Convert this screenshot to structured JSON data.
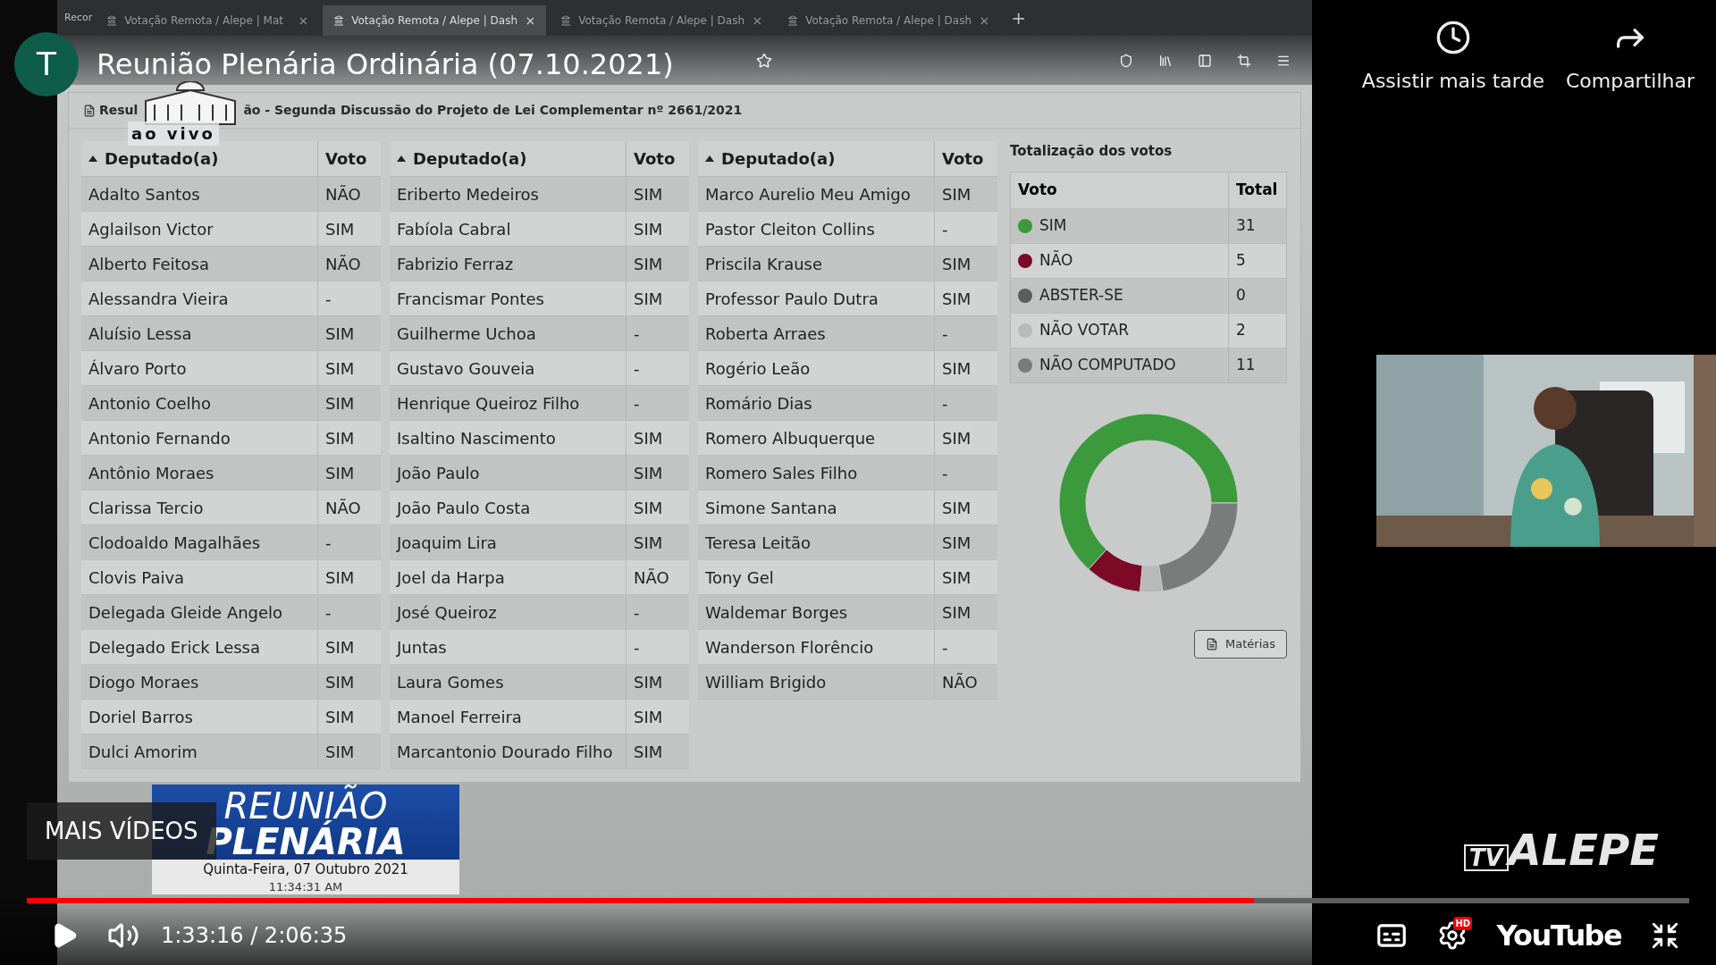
{
  "video": {
    "channel_initial": "T",
    "title": "Reunião Plenária Ordinária (07.10.2021)"
  },
  "browser": {
    "recording_label": "Recor",
    "tabs": [
      {
        "label": "Votação Remota / Alepe | Mat",
        "close": "×",
        "selected": false
      },
      {
        "label": "Votação Remota / Alepe | Dash",
        "close": "×",
        "selected": true
      },
      {
        "label": "Votação Remota / Alepe | Dash",
        "close": "×",
        "selected": false
      },
      {
        "label": "Votação Remota / Alepe | Dash",
        "close": "×",
        "selected": false
      }
    ],
    "new_tab": "+"
  },
  "panel": {
    "title_start": "Resul",
    "title_end": "ão - Segunda Discussão do Projeto de Lei Complementar nº 2661/2021",
    "live_label": "ao vivo"
  },
  "tables": [
    {
      "columns": [
        "Deputado(a)",
        "Voto"
      ],
      "rows": [
        [
          "Adalto Santos",
          "NÃO"
        ],
        [
          "Aglailson Victor",
          "SIM"
        ],
        [
          "Alberto Feitosa",
          "NÃO"
        ],
        [
          "Alessandra Vieira",
          "-"
        ],
        [
          "Aluísio Lessa",
          "SIM"
        ],
        [
          "Álvaro Porto",
          "SIM"
        ],
        [
          "Antonio Coelho",
          "SIM"
        ],
        [
          "Antonio Fernando",
          "SIM"
        ],
        [
          "Antônio Moraes",
          "SIM"
        ],
        [
          "Clarissa Tercio",
          "NÃO"
        ],
        [
          "Clodoaldo Magalhães",
          "-"
        ],
        [
          "Clovis Paiva",
          "SIM"
        ],
        [
          "Delegada Gleide Angelo",
          "-"
        ],
        [
          "Delegado Erick Lessa",
          "SIM"
        ],
        [
          "Diogo Moraes",
          "SIM"
        ],
        [
          "Doriel Barros",
          "SIM"
        ],
        [
          "Dulci Amorim",
          "SIM"
        ]
      ]
    },
    {
      "columns": [
        "Deputado(a)",
        "Voto"
      ],
      "rows": [
        [
          "Eriberto Medeiros",
          "SIM"
        ],
        [
          "Fabíola Cabral",
          "SIM"
        ],
        [
          "Fabrizio Ferraz",
          "SIM"
        ],
        [
          "Francismar Pontes",
          "SIM"
        ],
        [
          "Guilherme Uchoa",
          "-"
        ],
        [
          "Gustavo Gouveia",
          "-"
        ],
        [
          "Henrique Queiroz Filho",
          "-"
        ],
        [
          "Isaltino Nascimento",
          "SIM"
        ],
        [
          "João Paulo",
          "SIM"
        ],
        [
          "João Paulo Costa",
          "SIM"
        ],
        [
          "Joaquim Lira",
          "SIM"
        ],
        [
          "Joel da Harpa",
          "NÃO"
        ],
        [
          "José Queiroz",
          "-"
        ],
        [
          "Juntas",
          "-"
        ],
        [
          "Laura Gomes",
          "SIM"
        ],
        [
          "Manoel Ferreira",
          "SIM"
        ],
        [
          "Marcantonio Dourado Filho",
          "SIM"
        ]
      ]
    },
    {
      "columns": [
        "Deputado(a)",
        "Voto"
      ],
      "rows": [
        [
          "Marco Aurelio Meu Amigo",
          "SIM"
        ],
        [
          "Pastor Cleiton Collins",
          "-"
        ],
        [
          "Priscila Krause",
          "SIM"
        ],
        [
          "Professor Paulo Dutra",
          "SIM"
        ],
        [
          "Roberta Arraes",
          "-"
        ],
        [
          "Rogério Leão",
          "SIM"
        ],
        [
          "Romário Dias",
          "-"
        ],
        [
          "Romero Albuquerque",
          "SIM"
        ],
        [
          "Romero Sales Filho",
          "-"
        ],
        [
          "Simone Santana",
          "SIM"
        ],
        [
          "Teresa Leitão",
          "SIM"
        ],
        [
          "Tony Gel",
          "SIM"
        ],
        [
          "Waldemar Borges",
          "SIM"
        ],
        [
          "Wanderson Florêncio",
          "-"
        ],
        [
          "William Brigido",
          "NÃO"
        ]
      ]
    }
  ],
  "totals": {
    "title": "Totalização dos votos",
    "columns": [
      "Voto",
      "Total"
    ],
    "rows": [
      {
        "label": "SIM",
        "total": "31",
        "color": "#3a9a3c"
      },
      {
        "label": "NÃO",
        "total": "5",
        "color": "#7c0a26"
      },
      {
        "label": "ABSTER-SE",
        "total": "0",
        "color": "#5c5e5e"
      },
      {
        "label": "NÃO VOTAR",
        "total": "2",
        "color": "#b8baba"
      },
      {
        "label": "NÃO COMPUTADO",
        "total": "11",
        "color": "#7a7c7c"
      }
    ],
    "chart_data": {
      "type": "donut",
      "values": [
        63.3,
        10.2,
        0,
        4.1,
        22.4
      ]
    },
    "button": "Matérias"
  },
  "lower_third": {
    "title_1": "REUNIÃO",
    "title_2": "PLENÁRIA",
    "date": "Quinta-Feira, 07 Outubro 2021",
    "time": "11:34:31 AM"
  },
  "more_videos": "MAIS VÍDEOS",
  "actions": [
    {
      "kind": "clock",
      "label": "Assistir mais tarde"
    },
    {
      "kind": "share",
      "label": "Compartilhar"
    }
  ],
  "channel_logo": {
    "part_1": "TV",
    "part_2": "ALEPE"
  },
  "player": {
    "progress": {
      "level": 0.738
    },
    "time": "1:33:16 / 2:06:35",
    "logo": "YouTube",
    "hd": "HD"
  }
}
